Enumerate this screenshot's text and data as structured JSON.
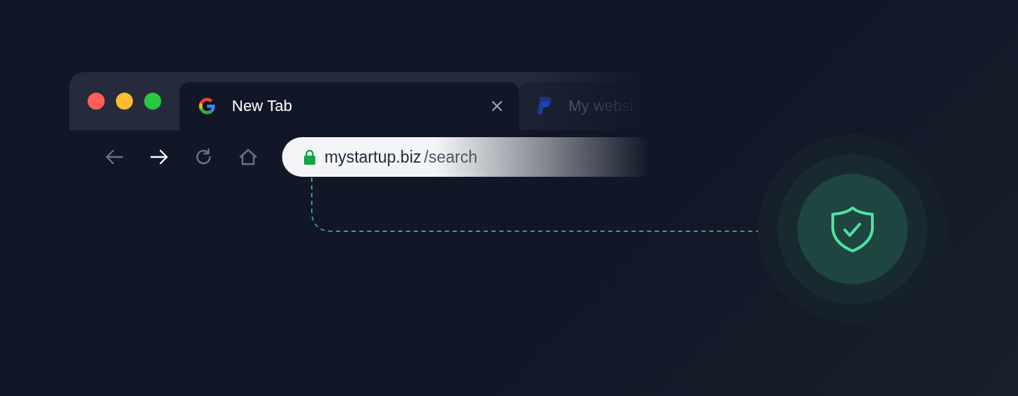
{
  "window_controls": [
    {
      "color": "#ff5f57"
    },
    {
      "color": "#febc2e"
    },
    {
      "color": "#28c840"
    }
  ],
  "tabs": [
    {
      "title": "New Tab",
      "kind": "google",
      "selected": true
    },
    {
      "title": "My websi",
      "kind": "paypal",
      "selected": false
    }
  ],
  "nav_buttons": [
    {
      "kind": "back",
      "active": false
    },
    {
      "kind": "forward",
      "active": true
    },
    {
      "kind": "reload",
      "active": false
    },
    {
      "kind": "home",
      "active": false
    }
  ],
  "address_bar": {
    "secure": true,
    "domain": "mystartup.biz",
    "path": "/search"
  },
  "security_badge": {
    "verified": true
  }
}
